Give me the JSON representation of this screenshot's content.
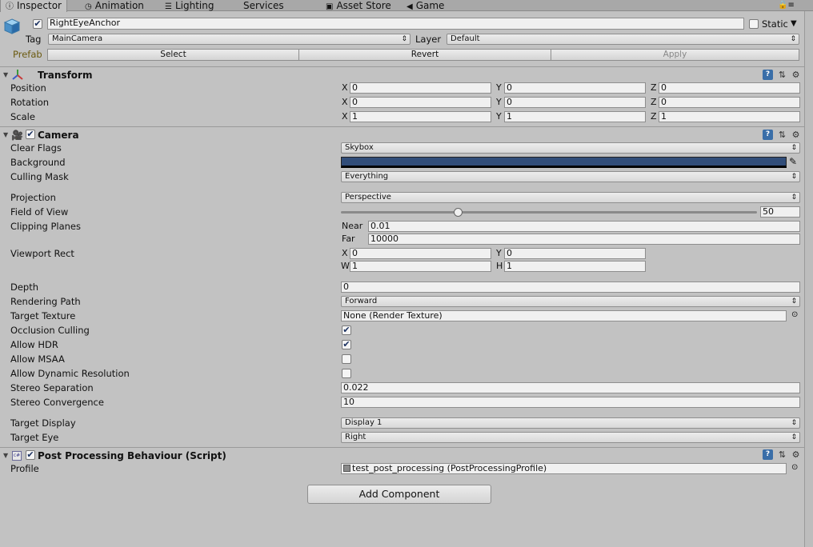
{
  "tabs": [
    {
      "label": "Inspector",
      "icon": "info-icon"
    },
    {
      "label": "Animation",
      "icon": "clock-icon"
    },
    {
      "label": "Lighting",
      "icon": "lighting-icon"
    },
    {
      "label": "Services",
      "icon": ""
    },
    {
      "label": "Asset Store",
      "icon": "store-icon"
    },
    {
      "label": "Game",
      "icon": "game-icon"
    }
  ],
  "object": {
    "name": "RightEyeAnchor",
    "active": true,
    "static_label": "Static",
    "tag_label": "Tag",
    "tag_value": "MainCamera",
    "layer_label": "Layer",
    "layer_value": "Default",
    "prefab_label": "Prefab",
    "prefab_select": "Select",
    "prefab_revert": "Revert",
    "prefab_apply": "Apply"
  },
  "transform": {
    "title": "Transform",
    "rows": [
      {
        "label": "Position",
        "x": "0",
        "y": "0",
        "z": "0"
      },
      {
        "label": "Rotation",
        "x": "0",
        "y": "0",
        "z": "0"
      },
      {
        "label": "Scale",
        "x": "1",
        "y": "1",
        "z": "1"
      }
    ],
    "axes": {
      "x": "X",
      "y": "Y",
      "z": "Z",
      "w": "W",
      "h": "H"
    }
  },
  "camera": {
    "title": "Camera",
    "enabled": true,
    "clear_flags": {
      "label": "Clear Flags",
      "value": "Skybox"
    },
    "background": {
      "label": "Background",
      "color": "#314d79"
    },
    "culling_mask": {
      "label": "Culling Mask",
      "value": "Everything"
    },
    "projection": {
      "label": "Projection",
      "value": "Perspective"
    },
    "fov": {
      "label": "Field of View",
      "value": "50",
      "fraction": 0.28
    },
    "clipping": {
      "label": "Clipping Planes",
      "near_label": "Near",
      "near": "0.01",
      "far_label": "Far",
      "far": "10000"
    },
    "viewport": {
      "label": "Viewport Rect",
      "x": "0",
      "y": "0",
      "w": "1",
      "h": "1"
    },
    "depth": {
      "label": "Depth",
      "value": "0"
    },
    "rendering_path": {
      "label": "Rendering Path",
      "value": "Forward"
    },
    "target_texture": {
      "label": "Target Texture",
      "value": "None (Render Texture)"
    },
    "occlusion_culling": {
      "label": "Occlusion Culling",
      "checked": true
    },
    "allow_hdr": {
      "label": "Allow HDR",
      "checked": true
    },
    "allow_msaa": {
      "label": "Allow MSAA",
      "checked": false
    },
    "allow_dynamic_resolution": {
      "label": "Allow Dynamic Resolution",
      "checked": false
    },
    "stereo_separation": {
      "label": "Stereo Separation",
      "value": "0.022"
    },
    "stereo_convergence": {
      "label": "Stereo Convergence",
      "value": "10"
    },
    "target_display": {
      "label": "Target Display",
      "value": "Display 1"
    },
    "target_eye": {
      "label": "Target Eye",
      "value": "Right"
    }
  },
  "post": {
    "title": "Post Processing Behaviour (Script)",
    "enabled": true,
    "profile_label": "Profile",
    "profile_value": "test_post_processing (PostProcessingProfile)"
  },
  "add_component": "Add Component",
  "colors": {
    "background": "#c2c2c2",
    "camera_bg": "#314d79",
    "help_icon": "#3a6ea8"
  }
}
